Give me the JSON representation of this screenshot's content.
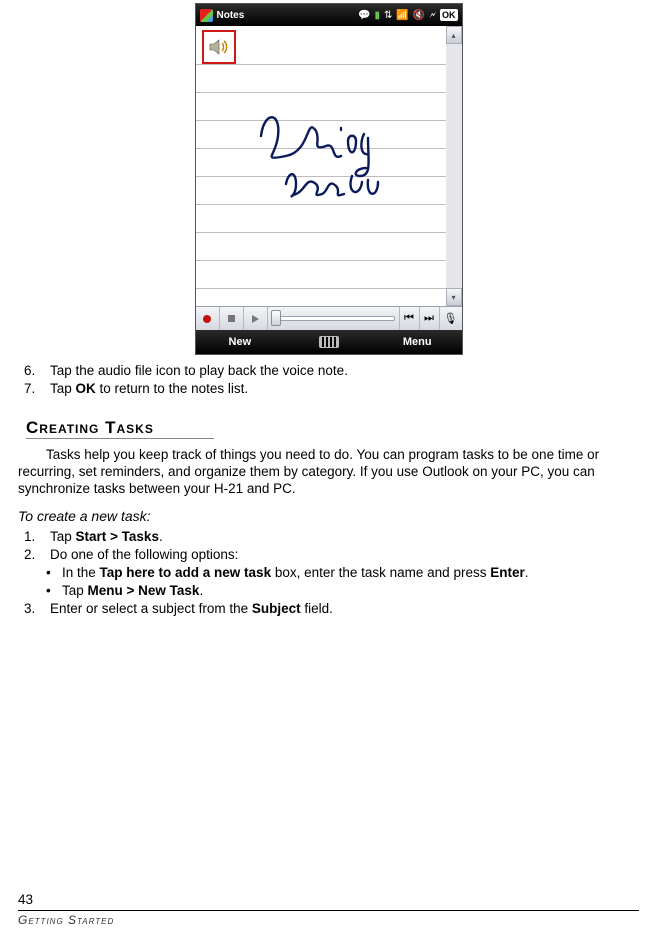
{
  "device": {
    "app_title": "Notes",
    "ok": "OK",
    "audio_icon": "speaker-icon",
    "handwriting_text": "Writing mode",
    "toolbar_labels": {
      "record": "",
      "stop": "",
      "play": ""
    },
    "softkeys": {
      "left": "New",
      "middle": "",
      "right": "Menu"
    },
    "tray_icons": [
      "chat",
      "signal",
      "sync",
      "antenna",
      "volume",
      "battery"
    ]
  },
  "doc": {
    "steps_top": [
      {
        "num": "6.",
        "text": "Tap the audio file icon to play back the voice note."
      },
      {
        "num": "7.",
        "text_pre": "Tap ",
        "bold": "OK",
        "text_post": " to return to the notes list."
      }
    ],
    "section_title": "Creating Tasks",
    "section_para": "Tasks help you keep track of things you need to do. You can program tasks to be one time or recurring, set reminders, and organize them by category. If you use Outlook on your PC, you can synchronize tasks between your H-21 and PC.",
    "subhead": "To create a new task:",
    "steps_task": [
      {
        "num": "1.",
        "segs": [
          {
            "t": "Tap "
          },
          {
            "b": "Start > Tasks"
          },
          {
            "t": "."
          }
        ]
      },
      {
        "num": "2.",
        "segs": [
          {
            "t": "Do one of the following options:"
          }
        ]
      }
    ],
    "bullets": [
      {
        "segs": [
          {
            "t": "In the "
          },
          {
            "b": "Tap here to add a new task"
          },
          {
            "t": " box, enter the task name and press "
          },
          {
            "b": "Enter"
          },
          {
            "t": "."
          }
        ]
      },
      {
        "segs": [
          {
            "t": "Tap "
          },
          {
            "b": "Menu > New Task"
          },
          {
            "t": "."
          }
        ]
      }
    ],
    "steps_task2": [
      {
        "num": "3.",
        "segs": [
          {
            "t": "Enter or select a subject from the "
          },
          {
            "b": "Subject"
          },
          {
            "t": " field."
          }
        ]
      }
    ],
    "page_number": "43",
    "footer": "Getting Started"
  }
}
